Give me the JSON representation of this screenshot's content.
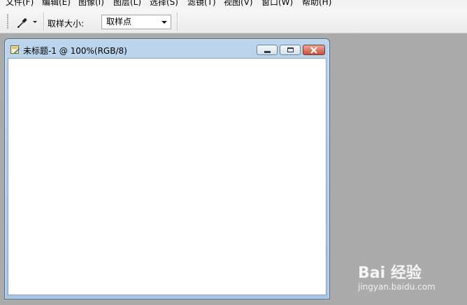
{
  "menu": [
    {
      "label": "文件(F)"
    },
    {
      "label": "编辑(E)"
    },
    {
      "label": "图像(I)"
    },
    {
      "label": "图层(L)"
    },
    {
      "label": "选择(S)"
    },
    {
      "label": "滤镜(T)"
    },
    {
      "label": "视图(V)"
    },
    {
      "label": "窗口(W)"
    },
    {
      "label": "帮助(H)"
    }
  ],
  "options": {
    "tool_icon": "eyedropper-icon",
    "sample_size_label": "取样大小:",
    "sample_size_value": "取样点"
  },
  "document": {
    "title": "未标题-1 @ 100%(RGB/8)",
    "icon": "document-icon"
  },
  "watermark": {
    "brand": "Bai 经验",
    "url": "jingyan.baidu.com"
  },
  "colors": {
    "workspace": "#ababab",
    "canvas": "#ffffff",
    "title_bar": "#b4cfe8",
    "close_button": "#c8503a"
  }
}
